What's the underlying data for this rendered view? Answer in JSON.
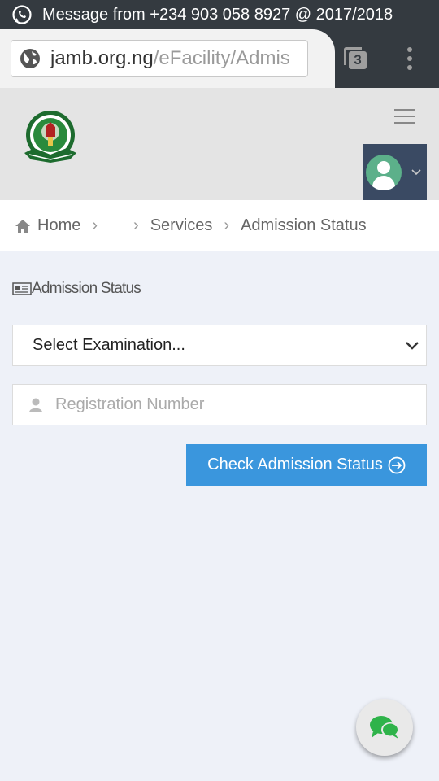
{
  "status_bar": {
    "message": "Message from +234 903 058 8927 @ 2017/2018",
    "icon": "whatsapp-icon"
  },
  "browser": {
    "url_host": "jamb.org.ng",
    "url_path": "/eFacility/Admis",
    "tab_count": "3"
  },
  "header": {
    "logo": "jamb-logo",
    "menu_icon": "hamburger-icon",
    "user_icon": "user-avatar-icon"
  },
  "breadcrumb": {
    "home": "Home",
    "services": "Services",
    "current": "Admission Status"
  },
  "main": {
    "section_title": "Admission Status",
    "select_value": "Select Examination...",
    "reg_placeholder": "Registration Number",
    "check_button": "Check Admission Status"
  },
  "colors": {
    "accent": "#3a96dd",
    "dark_bar": "#343a40",
    "user_box": "#3a4a63",
    "avatar": "#5cb08a",
    "chat_green": "#2fb34a"
  }
}
